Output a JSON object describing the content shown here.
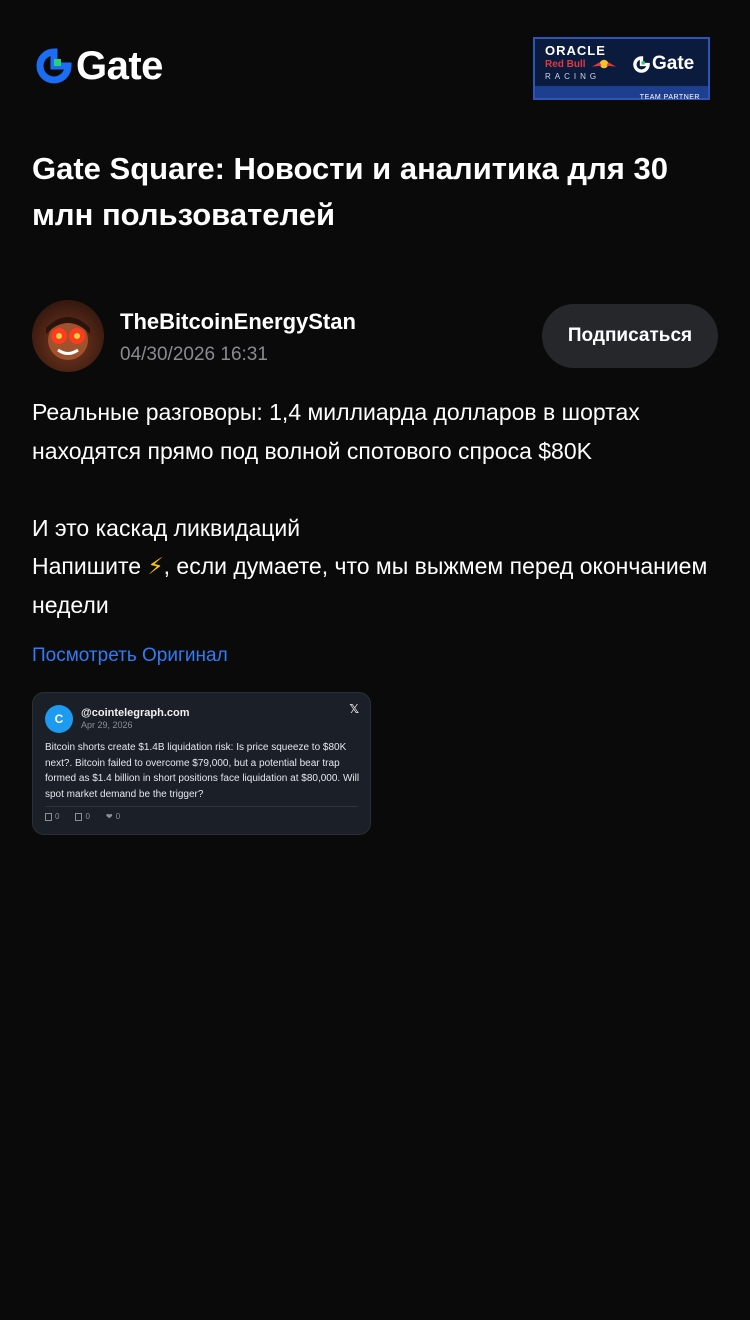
{
  "header": {
    "logo_text": "Gate",
    "partner": {
      "oracle": "ORACLE",
      "red_bull": "Red Bull",
      "racing": "RACING",
      "gate": "Gate",
      "team_partner": "TEAM PARTNER"
    }
  },
  "page_title": "Gate Square: Новости и аналитика для 30 млн пользователей",
  "post": {
    "author": "TheBitcoinEnergyStan",
    "timestamp": "04/30/2026 16:31",
    "follow_label": "Подписаться",
    "paragraph1": "Реальные разговоры: 1,4 миллиарда долларов в шортах находятся прямо под волной спотового спроса $80K",
    "paragraph2_line1": "И это каскад ликвидаций",
    "paragraph2_line2_before": "Напишите ",
    "emoji": "⚡",
    "paragraph2_line2_after": ", если думаете, что мы выжмем перед окончанием недели",
    "view_original_label": "Посмотреть Оригинал"
  },
  "tweet": {
    "avatar_letter": "C",
    "handle": "@cointelegraph.com",
    "date": "Apr 29, 2026",
    "x_glyph": "𝕏",
    "text": "Bitcoin shorts create $1.4B liquidation risk: Is price squeeze to $80K next?. Bitcoin failed to overcome $79,000, but a potential bear trap formed as $1.4 billion in short positions face liquidation at $80,000. Will spot market demand be the trigger?",
    "replies": "0",
    "retweets": "0",
    "likes": "0",
    "like_glyph": "❤"
  },
  "colors": {
    "background": "#0a0a0b",
    "link": "#2f7cf6",
    "button_bg": "#26272b",
    "gate_blue": "#1b6ef3",
    "gate_green": "#28d07a"
  },
  "icons": [
    "gate-logo-icon",
    "redbull-icon",
    "x-icon",
    "reply-icon",
    "retweet-icon",
    "heart-icon"
  ]
}
